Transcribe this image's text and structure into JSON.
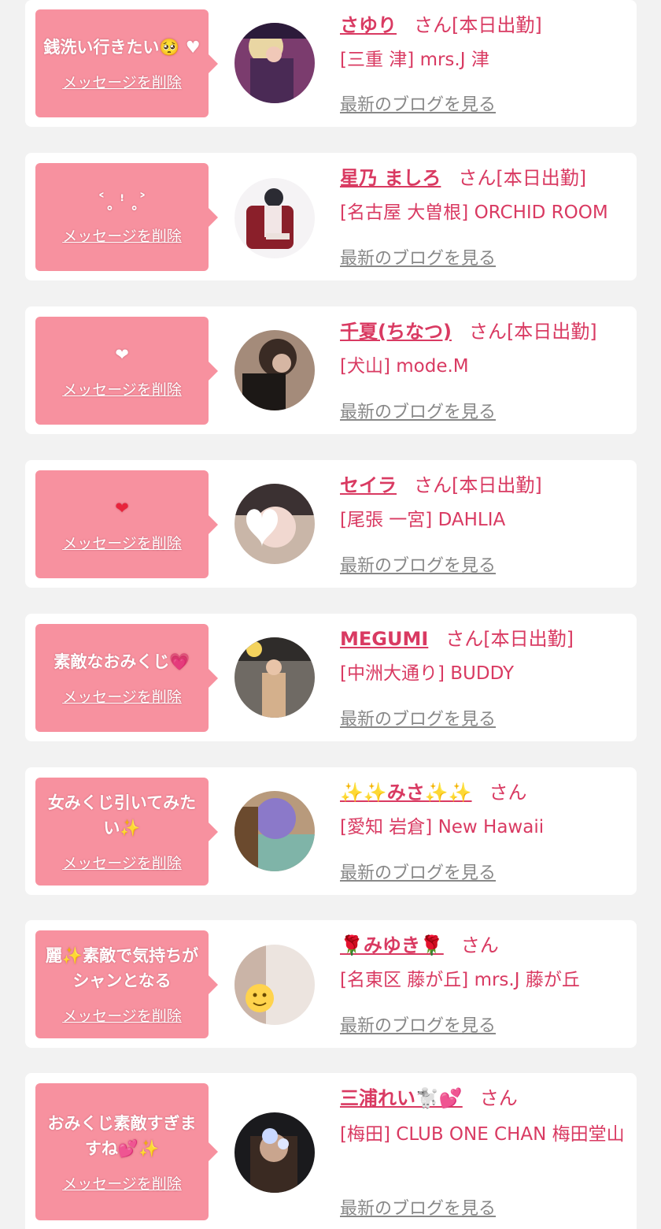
{
  "san_label": "さん",
  "delete_label": "メッセージを削除",
  "blog_label": "最新のブログを見る",
  "colors": {
    "accent": "#d93a62",
    "bubble": "#f7919f",
    "background": "#f2f2f2",
    "link_gray": "#888888"
  },
  "items": [
    {
      "message": "銭洗い行きたい",
      "message_emoji": "🥺 ♥",
      "name": "さゆり",
      "status": "[本日出勤]",
      "shop": "[三重 津] mrs.J 津"
    },
    {
      "message": "˂˳ ꜝ ˳˃",
      "name": "星乃 ましろ",
      "status": "[本日出勤]",
      "shop": "[名古屋 大曽根] ORCHID ROOM"
    },
    {
      "message": "❤",
      "name": "千夏(ちなつ)",
      "status": "[本日出勤]",
      "shop": "[犬山] mode.M"
    },
    {
      "message": "❤",
      "name": "セイラ",
      "status": "[本日出勤]",
      "shop": "[尾張 一宮] DAHLIA"
    },
    {
      "message": "素敵なおみくじ",
      "message_emoji": "💗",
      "name": "MEGUMI",
      "status": "[本日出勤]",
      "shop": "[中洲大通り] BUDDY"
    },
    {
      "message": "女みくじ引いてみたい",
      "message_emoji": "✨",
      "name": "✨✨みさ✨✨",
      "status": "",
      "shop": "[愛知 岩倉] New Hawaii"
    },
    {
      "message": "麗✨素敵で気持ちがシャンとなる",
      "name": "🌹みゆき🌹",
      "status": "",
      "shop": "[名東区 藤が丘] mrs.J 藤が丘"
    },
    {
      "message": "おみくじ素敵すぎますね",
      "message_emoji": "💕✨",
      "name": "三浦れい🐩💕",
      "status": "",
      "shop": "[梅田] CLUB ONE CHAN 梅田堂山"
    }
  ]
}
